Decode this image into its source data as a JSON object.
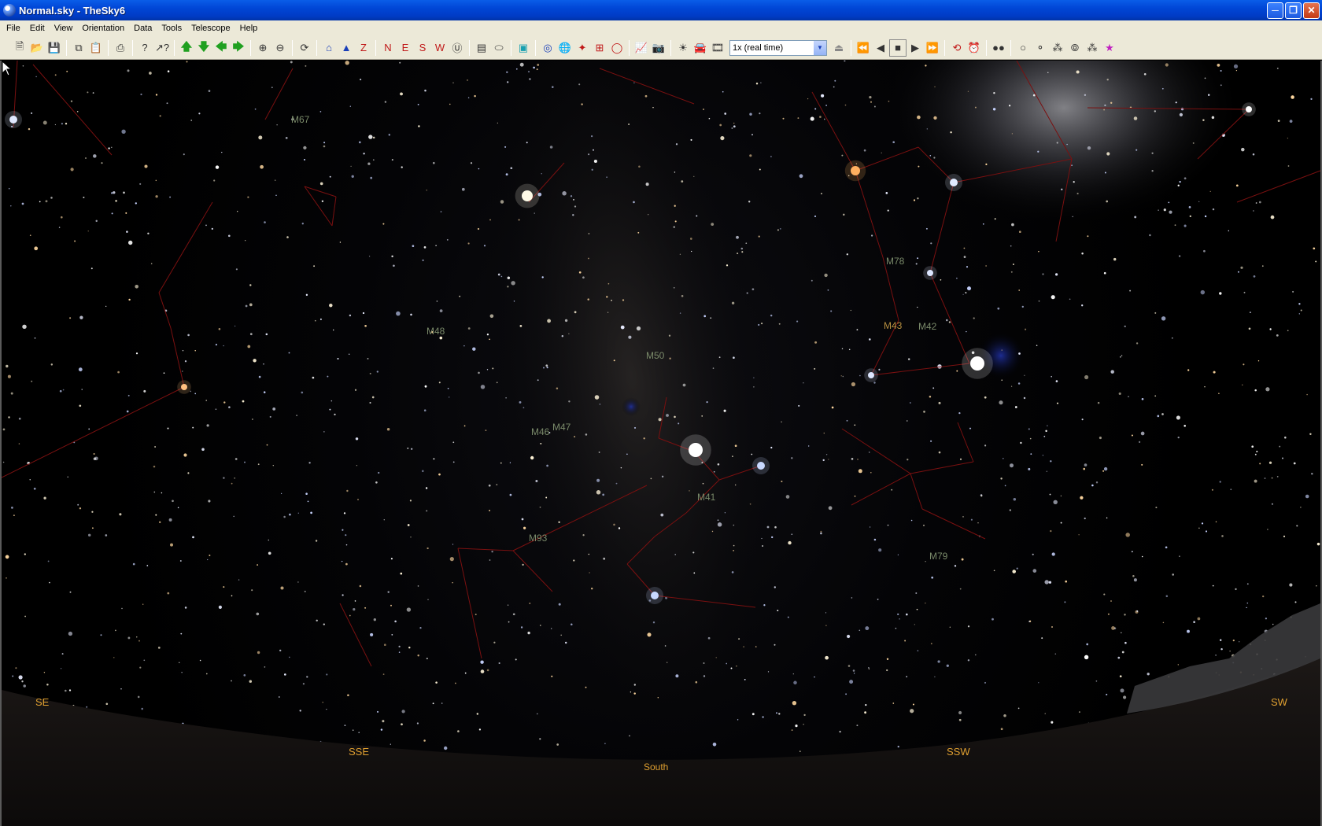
{
  "window": {
    "title": "Normal.sky - TheSky6"
  },
  "menu": [
    "File",
    "Edit",
    "View",
    "Orientation",
    "Data",
    "Tools",
    "Telescope",
    "Help"
  ],
  "toolbar": {
    "time_rate": "1x (real time)",
    "compass_N": "N",
    "compass_E": "E",
    "compass_S": "S",
    "compass_W": "W"
  },
  "sky": {
    "objects": {
      "m67": "M67",
      "m78": "M78",
      "m48": "M48",
      "m43": "M43",
      "m42": "M42",
      "m50": "M50",
      "m47": "M47",
      "m46": "M46",
      "m41": "M41",
      "m93": "M93",
      "m79": "M79"
    },
    "directions": {
      "se": "SE",
      "sse": "SSE",
      "south": "South",
      "ssw": "SSW",
      "sw": "SW"
    }
  }
}
